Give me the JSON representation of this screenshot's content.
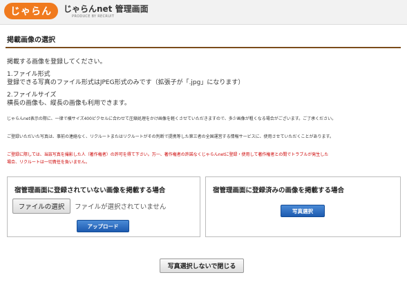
{
  "header": {
    "logo_text": "じゃらん",
    "brand": "じゃらんnet 管理画面",
    "brand_sub": "PRODUCE BY RECRUIT"
  },
  "page": {
    "title": "掲載画像の選択"
  },
  "intro": {
    "line1": "掲載する画像を登録してください。",
    "format_heading": "1.ファイル形式",
    "format_text": "登録できる写真のファイル形式はJPEG形式のみです（拡張子が「.jpg」になります）",
    "size_heading": "2.ファイルサイズ",
    "size_text": "横長の画像も、縦長の画像も利用できます。"
  },
  "notes": {
    "note1": "じゃらんnet表示の際に、一律で横サイズ400ピクセルに合わせて圧縮処理をかけ画像を軽くさせていただきますので、多少画像が粗くなる場合がございます。ご了承ください。",
    "note2": "ご登録いただいた写真は、事前の連絡なく、リクルートまたはリクルートがその判断で提携等した第三者の全国運営する情報サービスに、使用させていただくことがあります。",
    "note3_line1": "ご登録に際しては、当該写真を撮影した人（著作権者）の許可を得て下さい。万一、著作権者の許諾なくじゃらんnetに登録・使用して著作権者との間でトラブルが発生した",
    "note3_line2": "場合、リクルートは一切責任を負いません。"
  },
  "left_panel": {
    "title": "宿管理画面に登録されていない画像を掲載する場合",
    "file_button": "ファイルの選択",
    "file_status": "ファイルが選択されていません",
    "upload_button": "アップロード"
  },
  "right_panel": {
    "title": "宿管理画面に登録済みの画像を掲載する場合",
    "select_button": "写真選択"
  },
  "footer": {
    "close_button": "写真選択しないで閉じる"
  }
}
